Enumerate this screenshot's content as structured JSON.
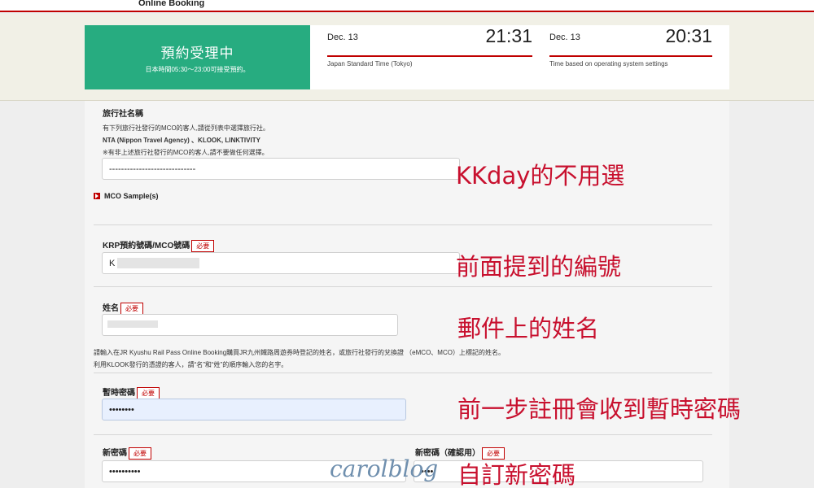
{
  "header": {
    "brand": "Online Booking"
  },
  "status": {
    "title": "預約受理中",
    "hours": "日本時間05:30～23:00可接受預約。"
  },
  "clocks": [
    {
      "date": "Dec. 13",
      "time": "21:31",
      "caption": "Japan Standard Time (Tokyo)"
    },
    {
      "date": "Dec. 13",
      "time": "20:31",
      "caption": "Time based on operating system settings"
    }
  ],
  "agency": {
    "label": "旅行社名稱",
    "note1": "有下列旅行社發行的MCO的客人,請從列表中選擇旅行社。",
    "note2": "NTA (Nippon Travel Agency) 、KLOOK, LINKTIVITY",
    "note3": "※有非上述旅行社發行的MCO的客人,請不要做任何選擇。",
    "value": "-----------------------------"
  },
  "mco_sample": "MCO Sample(s)",
  "required": "必要",
  "krp": {
    "label": "KRP預約號碼/MCO號碼",
    "value": "K"
  },
  "name": {
    "label": "姓名",
    "note1": "請輸入在JR Kyushu Rail Pass Online Booking購買JR九州鐵路周遊券時登記的姓名，或旅行社發行的兌換證 （eMCO、MCO）上標記的姓名。",
    "note2": "利用KLOOK發行的憑證的客人，請“名”和“姓”的順序輸入您的名字。"
  },
  "temp_password": {
    "label": "暫時密碼",
    "value": "••••••••"
  },
  "new_password": {
    "label": "新密碼",
    "value": "••••••••••"
  },
  "confirm_password": {
    "label": "新密碼（確認用）",
    "value": "••••"
  },
  "annotations": {
    "a1": "KKday的不用選",
    "a2": "前面提到的編號",
    "a3": "郵件上的姓名",
    "a4": "前一步註冊會收到暫時密碼",
    "a5": "自訂新密碼"
  },
  "watermark": "carolblog"
}
